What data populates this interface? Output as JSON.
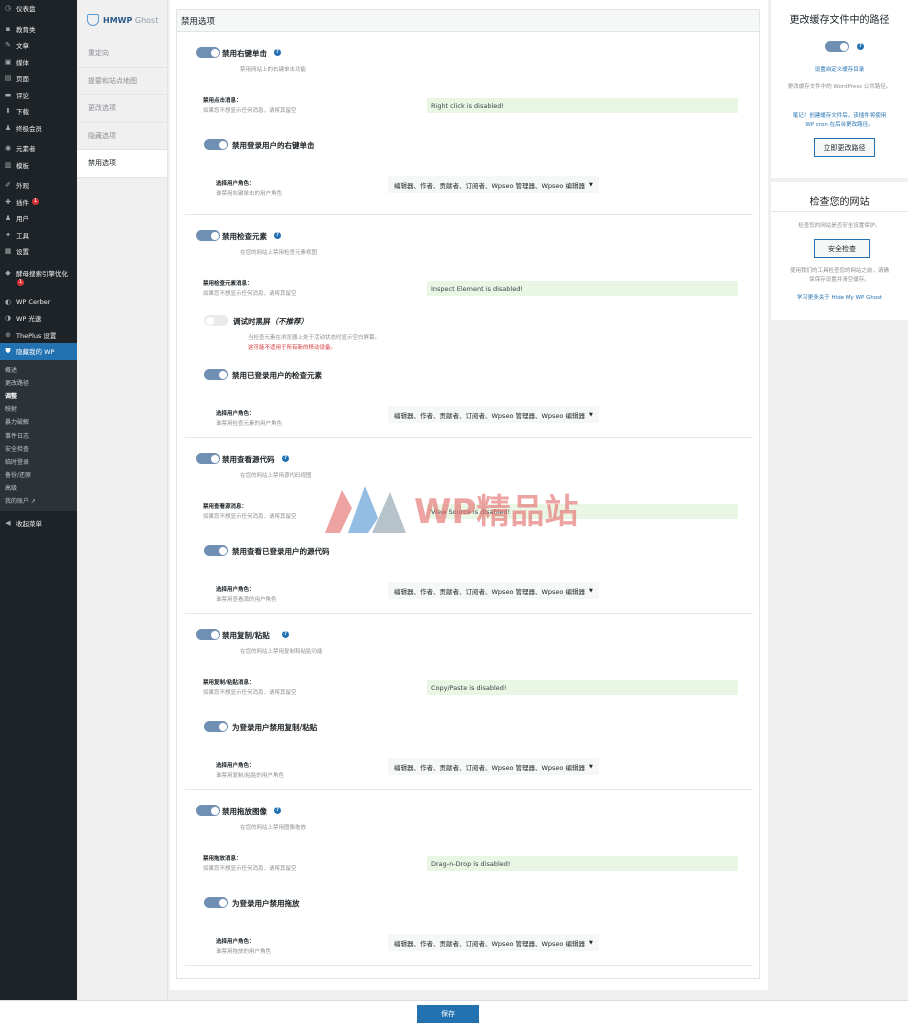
{
  "wp_sidebar": {
    "items": [
      {
        "icon": "dashboard-icon",
        "glyph": "◷",
        "label": "仪表盘"
      },
      {
        "icon": "education-icon",
        "glyph": "▪",
        "label": "教育类"
      },
      {
        "icon": "pin-icon",
        "glyph": "✎",
        "label": "文章"
      },
      {
        "icon": "media-icon",
        "glyph": "▣",
        "label": "媒体"
      },
      {
        "icon": "page-icon",
        "glyph": "▤",
        "label": "页面"
      },
      {
        "icon": "comment-icon",
        "glyph": "▬",
        "label": "评论"
      },
      {
        "icon": "download-icon",
        "glyph": "⬇",
        "label": "下载"
      },
      {
        "icon": "member-icon",
        "glyph": "♟",
        "label": "终极会员"
      },
      {
        "icon": "elementor-icon",
        "glyph": "◉",
        "label": "元素者"
      },
      {
        "icon": "template-icon",
        "glyph": "▥",
        "label": "模板"
      },
      {
        "icon": "appearance-icon",
        "glyph": "✐",
        "label": "外观"
      },
      {
        "icon": "plugin-icon",
        "glyph": "✚",
        "label": "插件",
        "badge": "1"
      },
      {
        "icon": "user-icon",
        "glyph": "♟",
        "label": "用户"
      },
      {
        "icon": "tools-icon",
        "glyph": "✦",
        "label": "工具"
      },
      {
        "icon": "settings-icon",
        "glyph": "▦",
        "label": "设置"
      },
      {
        "icon": "seo-icon",
        "glyph": "◆",
        "label": "酵母搜索引擎优化",
        "badge": "1"
      },
      {
        "icon": "cerber-icon",
        "glyph": "◐",
        "label": "WP Cerber"
      },
      {
        "icon": "wp-light-icon",
        "glyph": "◑",
        "label": "WP 光速"
      },
      {
        "icon": "theplus-icon",
        "glyph": "⊕",
        "label": "ThePlus 设置"
      },
      {
        "icon": "shield-icon",
        "glyph": "⛊",
        "label": "隐藏我的 WP"
      }
    ],
    "submenu": [
      "概述",
      "更改路径",
      "调整",
      "映射",
      "暴力破解",
      "事件日志",
      "安全检查",
      "临时登录",
      "备份/还原",
      "高级",
      "我的账户 ↗"
    ],
    "collapse_label": "收起菜单"
  },
  "plugin_nav": {
    "brand_bold": "HMWP",
    "brand_light": " Ghost",
    "items": [
      "重定向",
      "提要和站点地图",
      "更改选项",
      "隐藏选项",
      "禁用选项"
    ]
  },
  "panel": {
    "header": "禁用选项",
    "sections": [
      {
        "toggle_title": "禁用右键单击",
        "toggle_desc": "禁用网站上的右键单击功能",
        "message_label": "禁用点击消息：",
        "message_sub": "如果您不想显示任何消息，请将其留空",
        "message_value": "Right click is disabled!",
        "logged_title": "禁用登录用户的右键单击",
        "roles_label": "选择用户角色：",
        "roles_sub": "谁禁用右键单击的用户角色",
        "roles_value": "编辑器、作者、贡献者、订阅者、Wpseo 管理器、Wpseo 编辑器"
      },
      {
        "toggle_title": "禁用检查元素",
        "toggle_desc": "在您的网站上禁用检查元素视图",
        "message_label": "禁用检查元素消息：",
        "message_sub": "如果您不想显示任何消息，请将其留空",
        "message_value": "Inspect Element is disabled!",
        "debug_title": "调试时黑屏",
        "debug_note": "（不推荐）",
        "debug_desc": "当检查元素在浏览器上处于活动状态时显示空白屏幕。",
        "debug_warn": "这可能不适用于所有新的移动设备。",
        "logged_title": "禁用已登录用户的检查元素",
        "roles_label": "选择用户角色：",
        "roles_sub": "谁禁用检查元素的用户角色",
        "roles_value": "编辑器、作者、贡献者、订阅者、Wpseo 管理器、Wpseo 编辑器"
      },
      {
        "toggle_title": "禁用查看源代码",
        "toggle_desc": "在您的网站上禁用源代码视图",
        "message_label": "禁用查看源消息：",
        "message_sub": "如果您不想显示任何消息，请将其留空",
        "message_value": "View Source is disabled!",
        "logged_title": "禁用查看已登录用户的源代码",
        "roles_label": "选择用户角色：",
        "roles_sub": "谁禁用查看源的用户角色",
        "roles_value": "编辑器、作者、贡献者、订阅者、Wpseo 管理器、Wpseo 编辑器"
      },
      {
        "toggle_title": "禁用复制/粘贴",
        "toggle_desc": "在您的网站上禁用复制和粘贴功能",
        "message_label": "禁用复制/粘贴消息：",
        "message_sub": "如果您不想显示任何消息，请将其留空",
        "message_value": "Copy/Paste is disabled!",
        "logged_title": "为登录用户禁用复制/粘贴",
        "roles_label": "选择用户角色：",
        "roles_sub": "谁禁用复制/粘贴的用户角色",
        "roles_value": "编辑器、作者、贡献者、订阅者、Wpseo 管理器、Wpseo 编辑器"
      },
      {
        "toggle_title": "禁用拖放图像",
        "toggle_desc": "在您的网站上禁用图像拖放",
        "message_label": "禁用拖放消息：",
        "message_sub": "如果您不想显示任何消息，请将其留空",
        "message_value": "Drag-n-Drop is disabled!",
        "logged_title": "为登录用户禁用拖放",
        "roles_label": "选择用户角色：",
        "roles_sub": "谁禁用拖放的用户角色",
        "roles_value": "编辑器、作者、贡献者、订阅者、Wpseo 管理器、Wpseo 编辑器"
      }
    ]
  },
  "cache_card": {
    "title": "更改缓存文件中的路径",
    "link": "设置自定义缓存目录",
    "text": "更改缓存文件中的 WordPress 公共路径。",
    "note_line1": "笔记！创建缓存文件后，该插件将使用",
    "note_line2": "WP cron 在后台更改路径。",
    "button": "立即更改路径"
  },
  "check_card": {
    "title": "检查您的网站",
    "text": "检查您的网站是否安全设置保护。",
    "button": "安全检查",
    "note_line1": "使用我们的工具检查您的网站之前，请确",
    "note_line2": "保保存设置并清空缓存。",
    "link": "学习更多关于 Hide My WP Ghost"
  },
  "footer": {
    "save_label": "保存"
  },
  "watermark": {
    "text": "WP精品站"
  },
  "colors": {
    "accent": "#2271b1",
    "toggle_on": "#6f8fb3",
    "message_bg": "#e9f6e3",
    "sidebar_bg": "#1d2327"
  }
}
